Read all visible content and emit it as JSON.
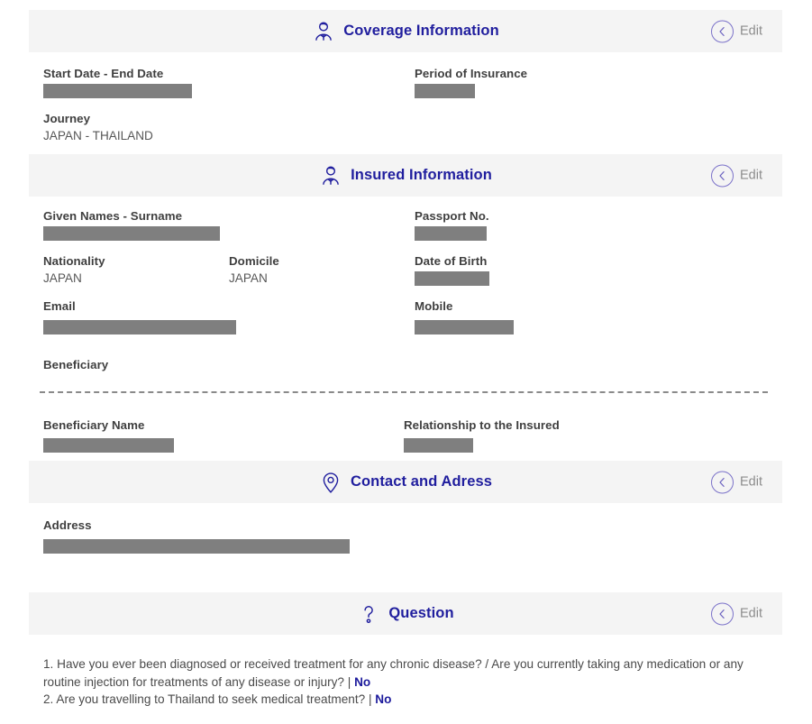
{
  "sections": [
    {
      "id": "coverage-information",
      "icon": "user-shield-icon",
      "title": "Coverage Information",
      "edit_label": "Edit",
      "edit_icon": "chevron-left-circle-icon"
    },
    {
      "id": "insured-information",
      "icon": "user-shield-icon",
      "title": "Insured Information",
      "edit_label": "Edit",
      "edit_icon": "chevron-left-circle-icon"
    },
    {
      "id": "contact-and-adress",
      "icon": "map-pin-icon",
      "title": "Contact and Adress",
      "edit_label": "Edit",
      "edit_icon": "chevron-left-circle-icon"
    },
    {
      "id": "question",
      "icon": "question-mark-icon",
      "title": "Question",
      "edit_label": "Edit",
      "edit_icon": "chevron-left-circle-icon"
    }
  ],
  "coverage": {
    "start_end_date": {
      "label": "Start Date - End Date",
      "value": "",
      "redacted": true
    },
    "period_of_insurance": {
      "label": "Period of Insurance",
      "value": "",
      "redacted": true
    },
    "journey": {
      "label": "Journey",
      "value": "JAPAN - THAILAND",
      "redacted": false
    }
  },
  "insured": {
    "given_names_surname": {
      "label": "Given Names - Surname",
      "value": "",
      "redacted": true
    },
    "passport_no": {
      "label": "Passport No.",
      "value": "",
      "redacted": true
    },
    "nationality": {
      "label": "Nationality",
      "value": "JAPAN",
      "redacted": false
    },
    "domicile": {
      "label": "Domicile",
      "value": "JAPAN",
      "redacted": false
    },
    "date_of_birth": {
      "label": "Date of Birth",
      "value": "",
      "redacted": true
    },
    "email": {
      "label": "Email",
      "value": "",
      "redacted": true
    },
    "mobile": {
      "label": "Mobile",
      "value": "",
      "redacted": true
    },
    "beneficiary_heading": "Beneficiary",
    "beneficiary_name": {
      "label": "Beneficiary Name",
      "value": "",
      "redacted": true
    },
    "relationship_to_insured": {
      "label": "Relationship to the Insured",
      "value": "",
      "redacted": true
    }
  },
  "contact": {
    "address": {
      "label": "Address",
      "value": "",
      "redacted": true
    }
  },
  "question": {
    "items": [
      {
        "number": "1.",
        "text": "Have you ever been diagnosed or received treatment for any chronic disease? / Are you currently taking any medication or any routine injection for treatments of any disease or injury?",
        "separator": "|",
        "answer": "No"
      },
      {
        "number": "2.",
        "text": "Are you travelling to Thailand to seek medical treatment?",
        "separator": "|",
        "answer": "No"
      }
    ]
  },
  "colors": {
    "brand_blue": "#201e9e",
    "band_gray": "#f4f4f4",
    "redaction_gray": "#7f7f7f",
    "edit_purple": "#7b72c9",
    "edit_text_gray": "#8c8c8c"
  }
}
